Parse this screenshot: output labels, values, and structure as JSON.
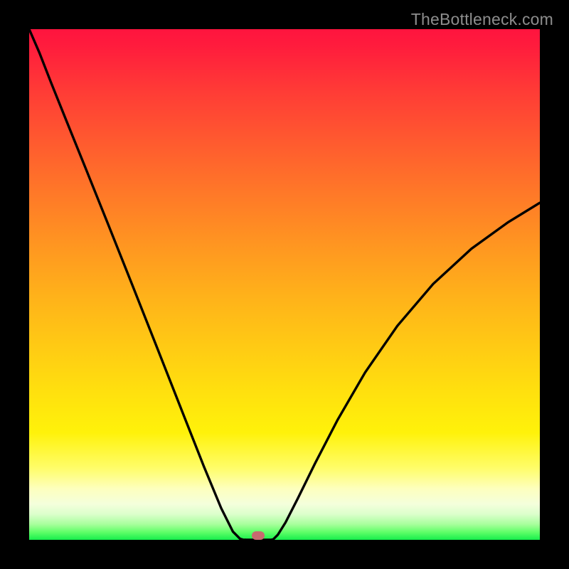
{
  "watermark": "TheBottleneck.com",
  "marker": {
    "x_pct": 44.8,
    "y_pct": 99.2,
    "color": "#c76a6f"
  },
  "chart_data": {
    "type": "line",
    "title": "",
    "xlabel": "",
    "ylabel": "",
    "xlim": [
      0,
      100
    ],
    "ylim": [
      0,
      100
    ],
    "grid": false,
    "left_branch": {
      "x": [
        0.0,
        2.0,
        4.3,
        7.4,
        11.2,
        15.5,
        20.2,
        25.1,
        29.9,
        34.2,
        37.6,
        39.9,
        41.3,
        42.0,
        42.3
      ],
      "y": [
        100.0,
        95.4,
        89.5,
        81.8,
        72.4,
        61.7,
        49.9,
        37.5,
        25.3,
        14.4,
        6.2,
        1.6,
        0.2,
        0.0,
        0.0
      ]
    },
    "right_branch": {
      "x": [
        47.4,
        47.8,
        48.7,
        50.2,
        52.6,
        56.0,
        60.4,
        65.8,
        72.1,
        79.1,
        86.6,
        93.8,
        100.0
      ],
      "y": [
        0.0,
        0.1,
        1.0,
        3.4,
        8.1,
        15.0,
        23.5,
        32.8,
        41.9,
        50.1,
        57.0,
        62.2,
        66.0
      ]
    },
    "optimum_x_pct": 44.8,
    "legend": null
  }
}
